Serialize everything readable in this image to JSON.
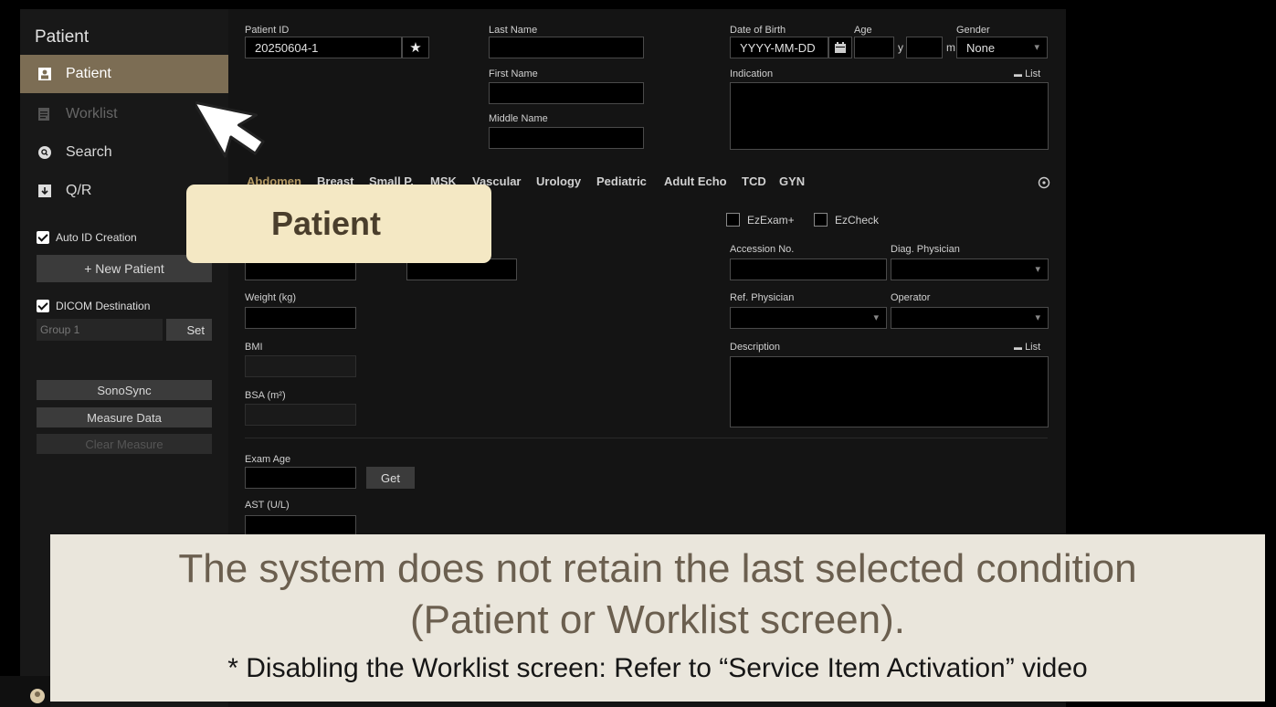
{
  "sidebar": {
    "title": "Patient",
    "nav": [
      {
        "label": "Patient",
        "icon": "patient-card-icon",
        "state": "active"
      },
      {
        "label": "Worklist",
        "icon": "worklist-icon",
        "state": "disabled"
      },
      {
        "label": "Search",
        "icon": "search-icon",
        "state": "normal"
      },
      {
        "label": "Q/R",
        "icon": "download-icon",
        "state": "normal"
      }
    ],
    "auto_id_label": "Auto ID Creation",
    "new_patient_label": "+ New Patient",
    "dicom_destination_label": "DICOM Destination",
    "group_value": "Group 1",
    "set_label": "Set",
    "sonosync_label": "SonoSync",
    "measure_data_label": "Measure Data",
    "clear_measure_label": "Clear Measure"
  },
  "form": {
    "patient_id_label": "Patient ID",
    "patient_id_value": "20250604-1",
    "last_name_label": "Last Name",
    "first_name_label": "First Name",
    "middle_name_label": "Middle Name",
    "dob_label": "Date of Birth",
    "dob_placeholder": "YYYY-MM-DD",
    "age_label": "Age",
    "age_y": "y",
    "age_m": "m",
    "gender_label": "Gender",
    "gender_value": "None",
    "indication_label": "Indication",
    "list_label": "List",
    "weight_label": "Weight (kg)",
    "bmi_label": "BMI",
    "bsa_label": "BSA (m²)",
    "exam_age_label": "Exam Age",
    "get_label": "Get",
    "ast_label": "AST (U/L)",
    "ezexam_label": "EzExam+",
    "ezcheck_label": "EzCheck",
    "accession_label": "Accession No.",
    "diag_physician_label": "Diag. Physician",
    "ref_physician_label": "Ref. Physician",
    "operator_label": "Operator",
    "description_label": "Description"
  },
  "tabs": [
    "Abdomen",
    "Breast",
    "Small P.",
    "MSK",
    "Vascular",
    "Urology",
    "Pediatric",
    "Adult Echo",
    "TCD",
    "GYN"
  ],
  "selected_tab": "Abdomen",
  "callout": {
    "text": "Patient"
  },
  "caption": {
    "line1": "The system does not retain the last selected condition",
    "line2": "(Patient or Worklist screen).",
    "line3": "* Disabling the Worklist screen:  Refer to “Service Item Activation” video"
  },
  "colors": {
    "accent": "#7c6d54",
    "tab_selected": "#b59a64",
    "callout_bg": "#f4e8c4",
    "caption_bg": "#eae6dc"
  }
}
